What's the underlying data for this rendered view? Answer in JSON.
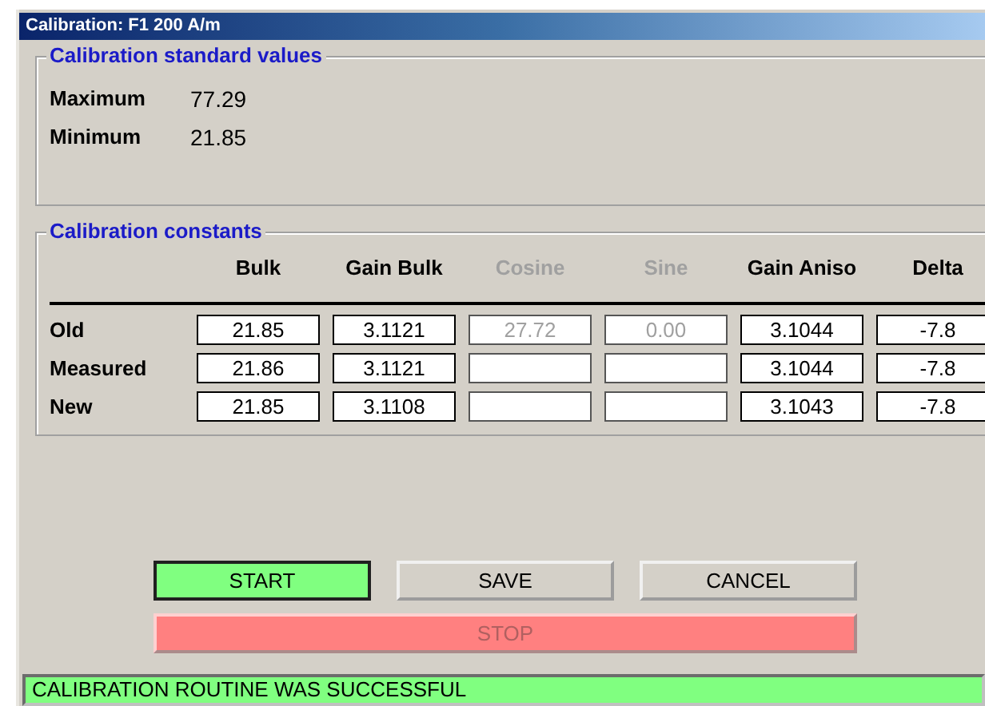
{
  "window": {
    "title": "Calibration: F1  200 A/m"
  },
  "standard_values": {
    "title": "Calibration standard values",
    "items": [
      {
        "label": "Maximum",
        "value": "77.29"
      },
      {
        "label": "Minimum",
        "value": "21.85"
      }
    ]
  },
  "constants": {
    "title": "Calibration constants",
    "columns": [
      {
        "label": "Bulk",
        "disabled": false
      },
      {
        "label": "Gain Bulk",
        "disabled": false
      },
      {
        "label": "Cosine",
        "disabled": true
      },
      {
        "label": "Sine",
        "disabled": true
      },
      {
        "label": "Gain Aniso",
        "disabled": false
      },
      {
        "label": "Delta",
        "disabled": false
      }
    ],
    "rows": [
      {
        "label": "Old",
        "cells": [
          "21.85",
          "3.1121",
          "27.72",
          "0.00",
          "3.1044",
          "-7.8"
        ]
      },
      {
        "label": "Measured",
        "cells": [
          "21.86",
          "3.1121",
          "",
          "",
          "3.1044",
          "-7.8"
        ]
      },
      {
        "label": "New",
        "cells": [
          "21.85",
          "3.1108",
          "",
          "",
          "3.1043",
          "-7.8"
        ]
      }
    ]
  },
  "buttons": [
    {
      "label": "START",
      "kind": "go",
      "disabled": false
    },
    {
      "label": "SAVE",
      "kind": "plain",
      "disabled": false
    },
    {
      "label": "CANCEL",
      "kind": "plain",
      "disabled": false
    }
  ],
  "stop_button": {
    "label": "STOP",
    "disabled": true
  },
  "status_bar": {
    "text": "CALIBRATION ROUTINE WAS SUCCESSFUL",
    "kind": "success"
  }
}
